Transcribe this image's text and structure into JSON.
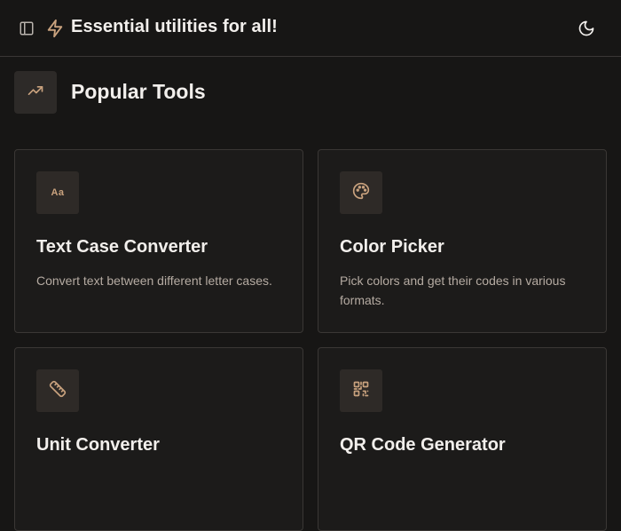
{
  "header": {
    "title": "Essential utilities for all!",
    "icons": [
      "sidebar-toggle-icon",
      "bolt-icon",
      "moon-icon"
    ]
  },
  "section": {
    "title": "Popular Tools",
    "icon": "trending-up-icon"
  },
  "tools": [
    {
      "title": "Text Case Converter",
      "description": "Convert text between different letter cases.",
      "icon": "text-case-icon",
      "icon_text": "Aa"
    },
    {
      "title": "Color Picker",
      "description": "Pick colors and get their codes in various formats.",
      "icon": "palette-icon"
    },
    {
      "title": "Unit Converter",
      "description": "",
      "icon": "ruler-icon"
    },
    {
      "title": "QR Code Generator",
      "description": "",
      "icon": "qr-code-icon"
    }
  ],
  "colors": {
    "background": "#171615",
    "card_background": "#1c1b1a",
    "border": "#3a3735",
    "accent": "#c9a27e",
    "text": "#f2efec",
    "muted_text": "#b5aba2"
  }
}
